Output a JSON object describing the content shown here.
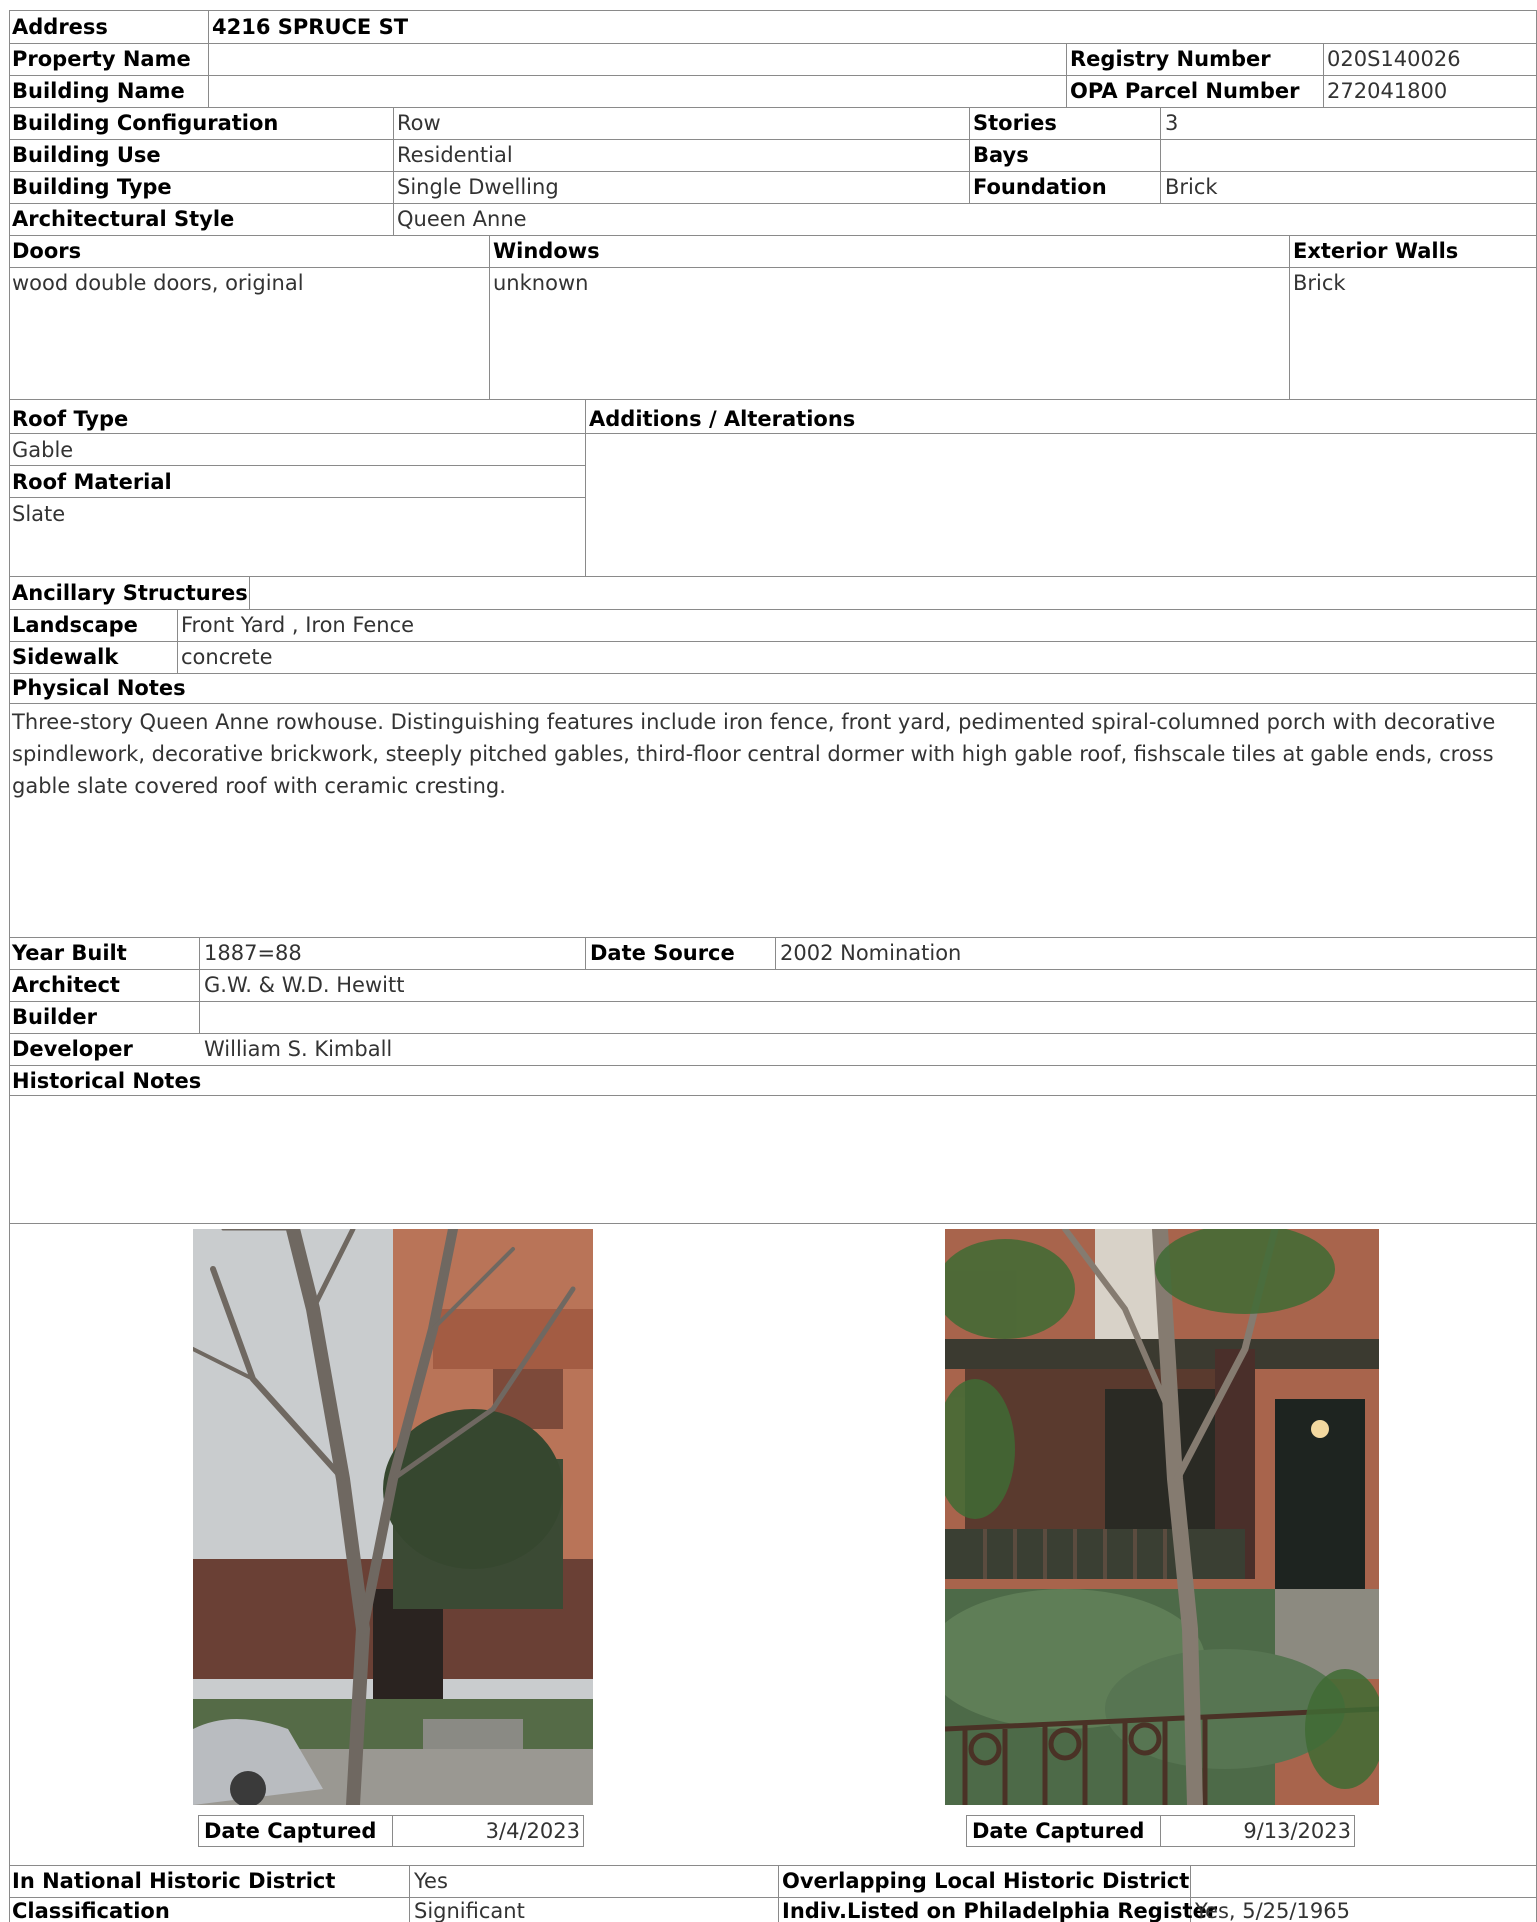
{
  "top": {
    "address_label": "Address",
    "address_value": "4216 SPRUCE ST",
    "property_name_label": "Property Name",
    "property_name_value": "",
    "registry_label": "Registry Number",
    "registry_value": "020S140026",
    "building_name_label": "Building Name",
    "building_name_value": "",
    "opa_label": "OPA Parcel Number",
    "opa_value": "272041800"
  },
  "building": {
    "config_label": "Building Configuration",
    "config_value": "Row",
    "stories_label": "Stories",
    "stories_value": "3",
    "use_label": "Building Use",
    "use_value": "Residential",
    "bays_label": "Bays",
    "bays_value": "",
    "type_label": "Building Type",
    "type_value": "Single Dwelling",
    "foundation_label": "Foundation",
    "foundation_value": "Brick",
    "style_label": "Architectural Style",
    "style_value": "Queen Anne"
  },
  "materials": {
    "doors_label": "Doors",
    "doors_value": "wood double doors, original",
    "windows_label": "Windows",
    "windows_value": "unknown",
    "walls_label": "Exterior Walls",
    "walls_value": "Brick"
  },
  "roof": {
    "type_label": "Roof Type",
    "type_value": "Gable",
    "material_label": "Roof Material",
    "material_value": "Slate",
    "additions_label": "Additions / Alterations",
    "additions_value": ""
  },
  "site": {
    "ancillary_label": "Ancillary Structures",
    "landscape_label": "Landscape",
    "landscape_value": "Front Yard , Iron Fence",
    "sidewalk_label": "Sidewalk",
    "sidewalk_value": "concrete",
    "physical_notes_label": "Physical Notes",
    "physical_notes_value": "Three-story Queen Anne rowhouse. Distinguishing features include iron fence, front yard, pedimented spiral-columned porch with decorative spindlework, decorative brickwork, steeply pitched gables, third-floor central dormer with high gable roof, fishscale tiles at gable ends, cross gable slate covered roof with ceramic cresting."
  },
  "history": {
    "year_built_label": "Year Built",
    "year_built_value": "1887=88",
    "date_source_label": "Date Source",
    "date_source_value": "2002 Nomination",
    "architect_label": "Architect",
    "architect_value": "G.W. & W.D. Hewitt",
    "builder_label": "Builder",
    "builder_value": "",
    "developer_label": "Developer",
    "developer_value": "William S. Kimball",
    "historical_notes_label": "Historical Notes",
    "historical_notes_value": ""
  },
  "photos": [
    {
      "date_label": "Date Captured",
      "date_value": "3/4/2023"
    },
    {
      "date_label": "Date Captured",
      "date_value": "9/13/2023"
    }
  ],
  "district": {
    "national_label": "In National Historic District",
    "national_value": "Yes",
    "local_label": "Overlapping Local Historic District",
    "local_value": "",
    "classification_label": "Classification",
    "classification_value": "Significant",
    "register_label": "Indiv.Listed on Philadelphia Register",
    "register_value": "Yes, 5/25/1965"
  }
}
